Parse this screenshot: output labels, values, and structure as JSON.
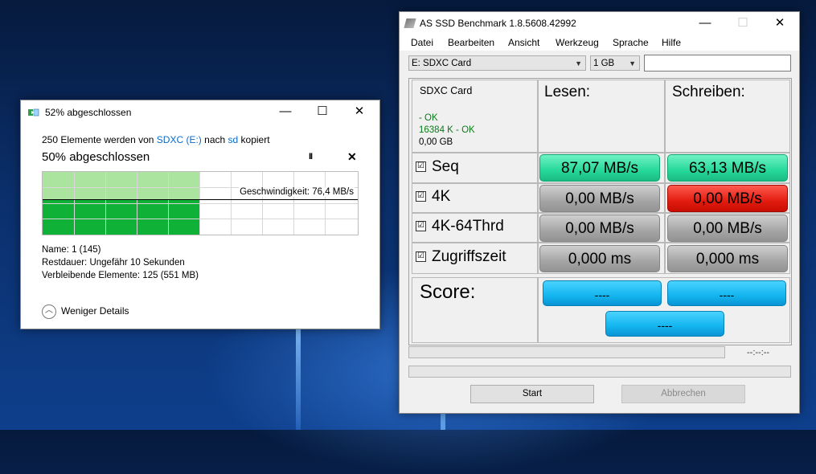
{
  "copy_dialog": {
    "title": "52% abgeschlossen",
    "desc_prefix": "250 Elemente werden von",
    "source": "SDXC (E:)",
    "desc_mid": "nach",
    "destination": "sd",
    "desc_suffix": "kopiert",
    "progress_title": "50% abgeschlossen",
    "progress_fraction": 0.5,
    "speed_label": "Geschwindigkeit: 76,4 MB/s",
    "pause_label": "II",
    "cancel_label": "✕",
    "name_line": "Name:  1 (145)",
    "remaining_time_line": "Restdauer:  Ungefähr 10 Sekunden",
    "remaining_items_line": "Verbleibende Elemente:  125 (551 MB)",
    "details_toggle": "Weniger Details",
    "colors": {
      "graph_light": "#a6e39a",
      "graph_dark": "#0fb236",
      "link": "#0a6bc8"
    }
  },
  "ssd_window": {
    "title": "AS SSD Benchmark 1.8.5608.42992",
    "menu": [
      "Datei",
      "Bearbeiten",
      "Ansicht",
      "Werkzeug",
      "Sprache",
      "Hilfe"
    ],
    "drive_select": "E: SDXC Card",
    "size_select": "1 GB",
    "device": {
      "name": "SDXC Card",
      "status1": " - OK",
      "status2": "16384 K - OK",
      "size": "0,00 GB"
    },
    "headers": {
      "read": "Lesen:",
      "write": "Schreiben:"
    },
    "rows": [
      {
        "label": "Seq",
        "checked": "☑",
        "read": "87,07 MB/s",
        "write": "63,13 MB/s"
      },
      {
        "label": "4K",
        "checked": "☑",
        "read": "0,00 MB/s",
        "write": "0,00 MB/s"
      },
      {
        "label": "4K-64Thrd",
        "checked": "☑",
        "read": "0,00 MB/s",
        "write": "0,00 MB/s"
      },
      {
        "label": "Zugriffszeit",
        "checked": "☑",
        "read": "0,000 ms",
        "write": "0,000 ms"
      }
    ],
    "score": {
      "label": "Score:",
      "read": "----",
      "write": "----",
      "total": "----"
    },
    "time": "--:--:--",
    "buttons": {
      "start": "Start",
      "abort": "Abbrechen"
    },
    "colors": {
      "green": "#26d89a",
      "grey": "#a5a5a5",
      "red": "#e31c10",
      "blue": "#13b5f0"
    }
  },
  "window_controls": {
    "minimize": "—",
    "maximize": "☐",
    "close": "✕"
  }
}
